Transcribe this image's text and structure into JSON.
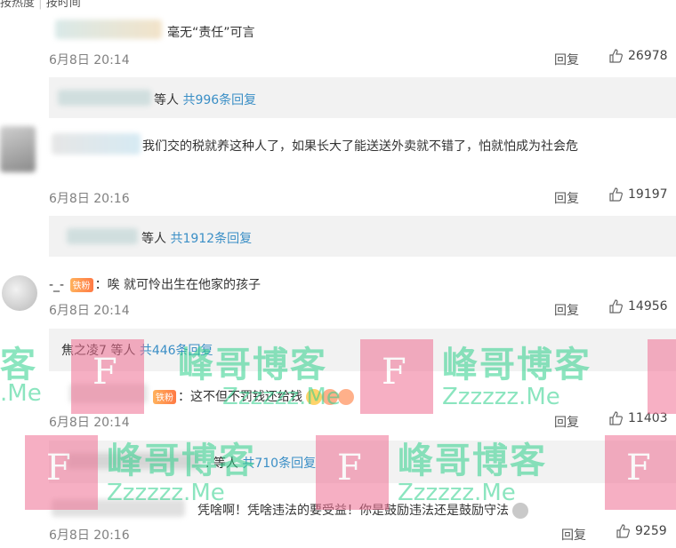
{
  "top_tabs": {
    "hot": "按热度",
    "time": "按时间"
  },
  "comments": [
    {
      "text": "毫无“责任”可言",
      "time": "6月8日 20:14",
      "reply_label": "回复",
      "likes": "26978",
      "sub": {
        "suffix": "等人",
        "count": "共996条回复"
      }
    },
    {
      "text": "我们交的税就养这种人了，如果长大了能送送外卖就不错了，怕就怕成为社会危",
      "time": "6月8日 20:16",
      "reply_label": "回复",
      "likes": "19197",
      "sub": {
        "suffix": "等人",
        "count": "共1912条回复"
      }
    },
    {
      "username": "-_-",
      "badge": "铁粉",
      "text": "唉 就可怜出生在他家的孩子",
      "time": "6月8日 20:14",
      "reply_label": "回复",
      "likes": "14956",
      "sub": {
        "prefix": "焦之凌7",
        "suffix": "等人",
        "count": "共446条回复"
      }
    },
    {
      "badge": "铁粉",
      "text": "这不但不罚钱还给钱",
      "time": "6月8日 20:14",
      "reply_label": "回复",
      "likes": "11403",
      "sub": {
        "prefix": ".",
        "suffix": "等人",
        "count": "共710条回复"
      }
    },
    {
      "text": "凭啥啊！凭啥违法的要受益！你是鼓励违法还是鼓励守法",
      "time": "6月8日 20:16",
      "reply_label": "回复",
      "likes": "9259"
    }
  ],
  "watermark": {
    "brand": "峰哥博客",
    "url": "Zzzzzz.Me",
    "letter": "F",
    "partial_brand": "客",
    "partial_url": ".Me"
  },
  "colors": {
    "watermark_pink": "#f06f93",
    "watermark_green": "#2ed08b",
    "count_blue": "#3b8fc6"
  }
}
